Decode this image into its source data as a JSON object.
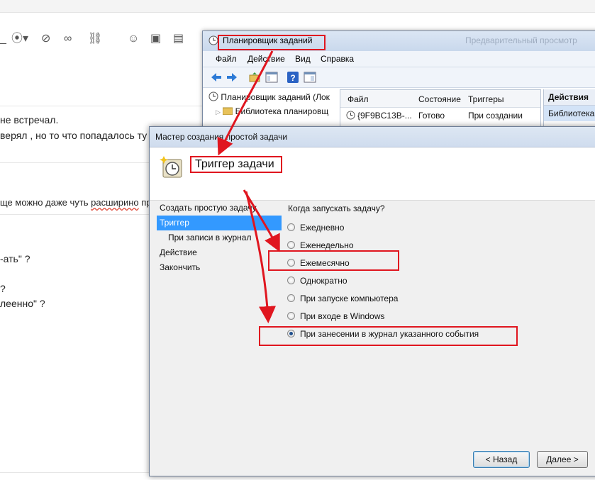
{
  "background": {
    "lines": [
      "не встречал.",
      "верял , но то что попадалось ту",
      "ще можно даже чуть расширино пр",
      "-ать\" ?",
      "?",
      "леенно\" ?"
    ]
  },
  "scheduler": {
    "title": "Планировщик заданий",
    "blurred_title": "Предварительный просмотр",
    "menu": [
      "Файл",
      "Действие",
      "Вид",
      "Справка"
    ],
    "tree": [
      "Планировщик заданий (Лок",
      "Библиотека планировщ"
    ],
    "columns": [
      "Файл",
      "Состояние",
      "Триггеры"
    ],
    "row": [
      "{9F9BC13B-...",
      "Готово",
      "При создании"
    ],
    "actions_header": "Действия",
    "actions_item": "Библиотека"
  },
  "wizard": {
    "title": "Мастер создания простой задачи",
    "heading": "Триггер задачи",
    "nav": [
      {
        "label": "Создать простую задачу",
        "sub": false,
        "selected": false
      },
      {
        "label": "Триггер",
        "sub": false,
        "selected": true
      },
      {
        "label": "При записи в журнал",
        "sub": true,
        "selected": false
      },
      {
        "label": "Действие",
        "sub": false,
        "selected": false
      },
      {
        "label": "Закончить",
        "sub": false,
        "selected": false
      }
    ],
    "question": "Когда запускать задачу?",
    "options": [
      {
        "label": "Ежедневно",
        "checked": false
      },
      {
        "label": "Еженедельно",
        "checked": false
      },
      {
        "label": "Ежемесячно",
        "checked": false
      },
      {
        "label": "Однократно",
        "checked": false
      },
      {
        "label": "При запуске компьютера",
        "checked": false
      },
      {
        "label": "При входе в Windows",
        "checked": false
      },
      {
        "label": "При занесении в журнал указанного события",
        "checked": true
      }
    ],
    "back_label": "< Назад",
    "next_label": "Далее >"
  },
  "colors": {
    "annotation_red": "#e0161f",
    "selected_nav": "#3399ff"
  }
}
